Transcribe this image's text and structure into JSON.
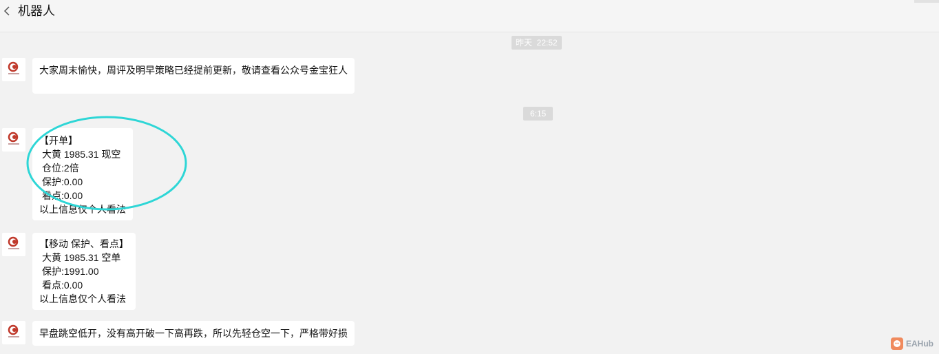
{
  "header": {
    "title": "机器人",
    "back_icon": "chevron-left-icon"
  },
  "timestamps": [
    "昨天  22:52",
    "6:15"
  ],
  "messages": [
    {
      "lines": [
        "大家周末愉快，周评及明早策略已经提前更新，敬请查看公众号金宝狂人"
      ]
    },
    {
      "lines": [
        "【开单】",
        "大黄 1985.31 现空",
        "仓位:2倍",
        "保护:0.00",
        "看点:0.00",
        "以上信息仅个人看法"
      ]
    },
    {
      "lines": [
        "【移动 保护、看点】",
        "大黄 1985.31 空单",
        "保护:1991.00",
        "看点:0.00",
        "以上信息仅个人看法"
      ]
    },
    {
      "lines": [
        "早盘跳空低开，没有高开破一下高再跌，所以先轻仓空一下，严格带好损"
      ]
    }
  ],
  "annotation_color": "#2ed6d6",
  "watermark": {
    "text": "EAHub",
    "icon": "eahub-logo-icon",
    "color": "#f08a5d"
  },
  "colors": {
    "background": "#f2f2f2",
    "bubble": "#ffffff",
    "timestamp_bg": "#dadada",
    "avatar_accent": "#c0392b"
  }
}
